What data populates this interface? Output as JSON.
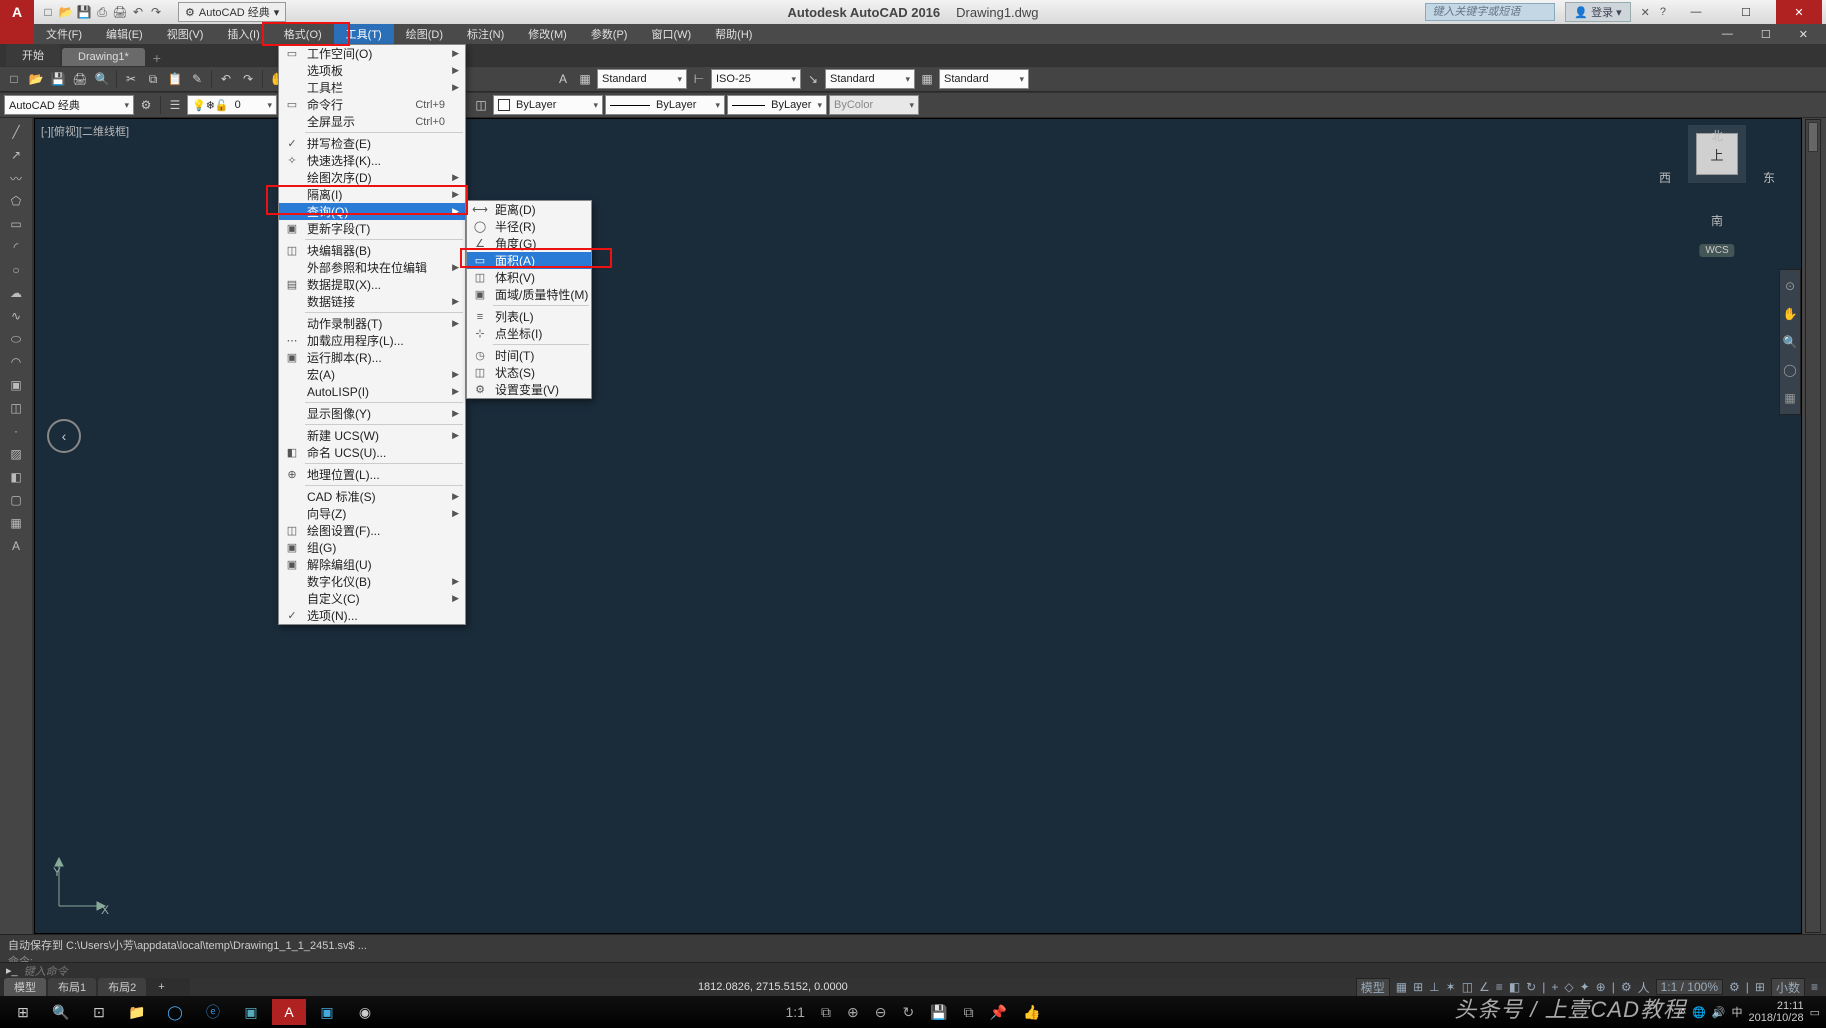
{
  "title": {
    "app": "Autodesk AutoCAD 2016",
    "doc": "Drawing1.dwg"
  },
  "workspace_combo": "AutoCAD 经典",
  "menubar": [
    "文件(F)",
    "编辑(E)",
    "视图(V)",
    "插入(I)",
    "格式(O)",
    "工具(T)",
    "绘图(D)",
    "标注(N)",
    "修改(M)",
    "参数(P)",
    "窗口(W)",
    "帮助(H)"
  ],
  "menubar_active_index": 5,
  "file_tabs": {
    "start": "开始",
    "active": "Drawing1*"
  },
  "toolbar_combos": {
    "layer": "0",
    "style1": "Standard",
    "style2": "ISO-25",
    "style3": "Standard",
    "style4": "Standard",
    "color": "ByLayer",
    "ltype": "ByLayer",
    "lweight": "ByLayer",
    "plot": "ByColor",
    "ws_combo": "AutoCAD 经典"
  },
  "canvas": {
    "viewtag": "[-][俯视][二维线框]"
  },
  "viewcube": {
    "n": "北",
    "s": "南",
    "e": "东",
    "w": "西",
    "top": "上",
    "wcs": "WCS"
  },
  "tools_menu": [
    {
      "t": "工作空间(O)",
      "ic": "▭",
      "sub": true
    },
    {
      "t": "选项板",
      "sub": true
    },
    {
      "t": "工具栏",
      "sub": true
    },
    {
      "t": "命令行",
      "ic": "▭",
      "sc": "Ctrl+9"
    },
    {
      "t": "全屏显示",
      "sc": "Ctrl+0"
    },
    {
      "hr": true
    },
    {
      "t": "拼写检查(E)",
      "ic": "✓"
    },
    {
      "t": "快速选择(K)...",
      "ic": "✧"
    },
    {
      "t": "绘图次序(D)",
      "sub": true
    },
    {
      "t": "隔离(I)",
      "sub": true
    },
    {
      "t": "查询(Q)",
      "sub": true,
      "hl": true
    },
    {
      "t": "更新字段(T)",
      "ic": "▣"
    },
    {
      "hr": true
    },
    {
      "t": "块编辑器(B)",
      "ic": "◫"
    },
    {
      "t": "外部参照和块在位编辑",
      "sub": true
    },
    {
      "t": "数据提取(X)...",
      "ic": "▤"
    },
    {
      "t": "数据链接",
      "sub": true
    },
    {
      "hr": true
    },
    {
      "t": "动作录制器(T)",
      "sub": true
    },
    {
      "t": "加载应用程序(L)...",
      "ic": "⋯"
    },
    {
      "t": "运行脚本(R)...",
      "ic": "▣"
    },
    {
      "t": "宏(A)",
      "sub": true
    },
    {
      "t": "AutoLISP(I)",
      "sub": true
    },
    {
      "hr": true
    },
    {
      "t": "显示图像(Y)",
      "sub": true
    },
    {
      "hr": true
    },
    {
      "t": "新建 UCS(W)",
      "sub": true
    },
    {
      "t": "命名 UCS(U)...",
      "ic": "◧"
    },
    {
      "hr": true
    },
    {
      "t": "地理位置(L)...",
      "ic": "⊕"
    },
    {
      "hr": true
    },
    {
      "t": "CAD 标准(S)",
      "sub": true
    },
    {
      "t": "向导(Z)",
      "sub": true
    },
    {
      "t": "绘图设置(F)...",
      "ic": "◫"
    },
    {
      "t": "组(G)",
      "ic": "▣"
    },
    {
      "t": "解除编组(U)",
      "ic": "▣"
    },
    {
      "t": "数字化仪(B)",
      "sub": true
    },
    {
      "t": "自定义(C)",
      "sub": true
    },
    {
      "t": "选项(N)...",
      "ic": "✓"
    }
  ],
  "query_menu": [
    {
      "t": "距离(D)",
      "ic": "⟷"
    },
    {
      "t": "半径(R)",
      "ic": "◯"
    },
    {
      "t": "角度(G)",
      "ic": "∠"
    },
    {
      "t": "面积(A)",
      "ic": "▭",
      "hl": true
    },
    {
      "t": "体积(V)",
      "ic": "◫"
    },
    {
      "t": "面域/质量特性(M)",
      "ic": "▣"
    },
    {
      "hr": true
    },
    {
      "t": "列表(L)",
      "ic": "≡"
    },
    {
      "t": "点坐标(I)",
      "ic": "⊹"
    },
    {
      "hr": true
    },
    {
      "t": "时间(T)",
      "ic": "◷"
    },
    {
      "t": "状态(S)",
      "ic": "◫"
    },
    {
      "t": "设置变量(V)",
      "ic": "⚙"
    }
  ],
  "cmd": {
    "l1": "自动保存到 C:\\Users\\小芳\\appdata\\local\\temp\\Drawing1_1_1_2451.sv$ ...",
    "l2": "命令:",
    "prompt": "键入命令"
  },
  "layout_tabs": [
    "模型",
    "布局1",
    "布局2"
  ],
  "status": {
    "coords": "1812.0826, 2715.5152, 0.0000",
    "model": "模型",
    "scale": "1:1 / 100%",
    "annoscale": "小数"
  },
  "titlebar_right": {
    "search_ph": "键入关键字或短语",
    "login": "登录"
  },
  "watermark": "头条号 / 上壹CAD教程",
  "clock": {
    "time": "21:11",
    "date": "2018/10/28"
  },
  "center_icons": {
    "ratio": "1:1"
  }
}
